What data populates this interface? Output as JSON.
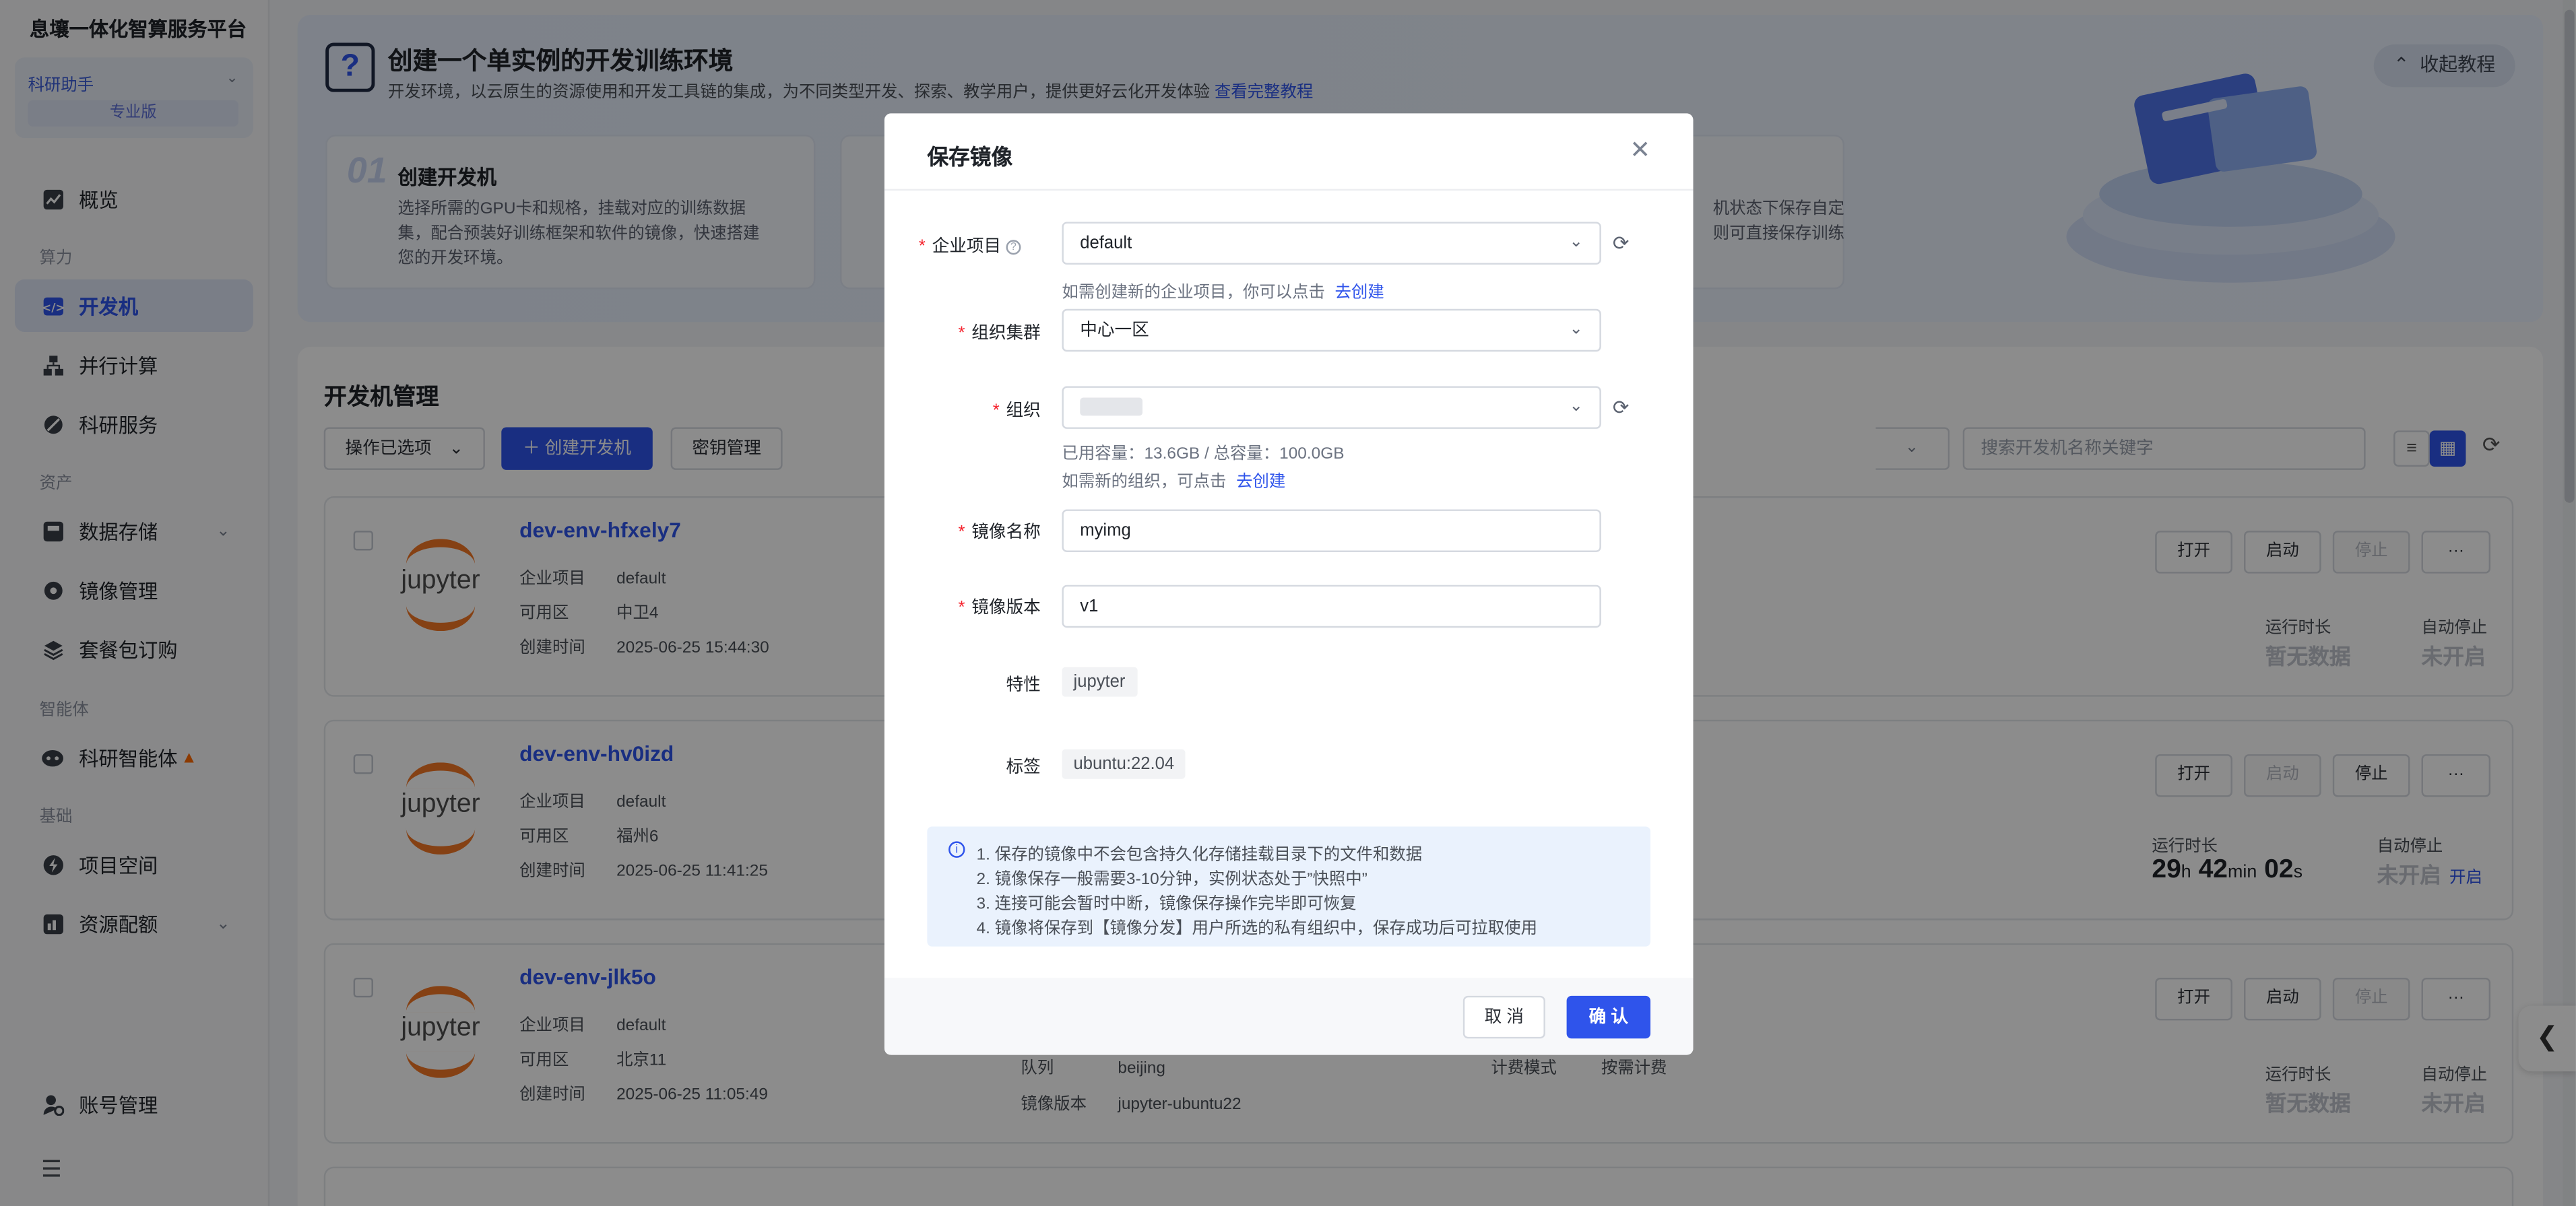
{
  "sidebar": {
    "brand": "息壤一体化智算服务平台",
    "project": {
      "name": "科研助手",
      "edition": "专业版"
    },
    "items": [
      {
        "label": "概览"
      },
      {
        "section": "算力"
      },
      {
        "label": "开发机"
      },
      {
        "label": "并行计算"
      },
      {
        "label": "科研服务"
      },
      {
        "section": "资产"
      },
      {
        "label": "数据存储"
      },
      {
        "label": "镜像管理"
      },
      {
        "label": "套餐包订购"
      },
      {
        "section": "智能体"
      },
      {
        "label": "科研智能体"
      },
      {
        "section": "基础"
      },
      {
        "label": "项目空间"
      },
      {
        "label": "资源配额"
      },
      {
        "label": "账号管理"
      }
    ]
  },
  "hero": {
    "title": "创建一个单实例的开发训练环境",
    "subtitle": "开发环境，以云原生的资源使用和开发工具链的集成，为不同类型开发、探索、教学用户，提供更好云化开发体验",
    "link": "查看完整教程",
    "collapse": "收起教程",
    "step1": {
      "num": "01",
      "title": "创建开发机",
      "desc": "选择所需的GPU卡和规格，挂载对应的训练数据集，配合预装好训练框架和软件的镜像，快速搭建您的开发环境。"
    },
    "step3": {
      "desc1": "机状态下保存自定",
      "desc2": "则可直接保存训练"
    }
  },
  "panel": {
    "title": "开发机管理",
    "ops": "操作已选项",
    "create": "创建开发机",
    "keys": "密钥管理",
    "search_placeholder": "搜索开发机名称关键字"
  },
  "instances": [
    {
      "name": "dev-env-hfxely7",
      "project_k": "企业项目",
      "project_v": "default",
      "zone_k": "可用区",
      "zone_v": "中卫4",
      "time_k": "创建时间",
      "time_v": "2025-06-25 15:44:30",
      "runtime": "暂无数据",
      "autostop": "未开启"
    },
    {
      "name": "dev-env-hv0izd",
      "project_k": "企业项目",
      "project_v": "default",
      "zone_k": "可用区",
      "zone_v": "福州6",
      "time_k": "创建时间",
      "time_v": "2025-06-25 11:41:25",
      "runtime": {
        "h": "29",
        "m": "42",
        "s": "02"
      },
      "autostop": "未开启",
      "open": "开启"
    },
    {
      "name": "dev-env-jlk5o",
      "project_k": "企业项目",
      "project_v": "default",
      "zone_k": "可用区",
      "zone_v": "北京11",
      "time_k": "创建时间",
      "time_v": "2025-06-25 11:05:49",
      "queue_k": "队列",
      "queue_v": "beijing",
      "ver_k": "镜像版本",
      "ver_v": "jupyter-ubuntu22",
      "bill_k": "计费模式",
      "bill_v": "按需计费",
      "runtime": "暂无数据",
      "autostop": "未开启"
    }
  ],
  "actions": {
    "open": "打开",
    "start": "启动",
    "stop": "停止",
    "more": "···"
  },
  "labels": {
    "runtime": "运行时长",
    "autostop": "自动停止",
    "h": "h",
    "min": "min",
    "s": "s"
  },
  "jupyter": "jupyter",
  "modal": {
    "title": "保存镜像",
    "project_label": "企业项目",
    "project_value": "default",
    "project_hint": "如需创建新的企业项目，你可以点击",
    "project_link": "去创建",
    "cluster_label": "组织集群",
    "cluster_value": "中心一区",
    "org_label": "组织",
    "org_usage": "已用容量：13.6GB / 总容量：100.0GB",
    "org_hint": "如需新的组织，可点击",
    "org_link": "去创建",
    "name_label": "镜像名称",
    "name_value": "myimg",
    "version_label": "镜像版本",
    "version_value": "v1",
    "feature_label": "特性",
    "feature_value": "jupyter",
    "tag_label": "标签",
    "tag_value": "ubuntu:22.04",
    "notice": [
      "1. 保存的镜像中不会包含持久化存储挂载目录下的文件和数据",
      "2. 镜像保存一般需要3-10分钟，实例状态处于”快照中”",
      "3. 连接可能会暂时中断，镜像保存操作完毕即可恢复",
      "4. 镜像将保存到【镜像分发】用户所选的私有组织中，保存成功后可拉取使用"
    ],
    "cancel": "取 消",
    "ok": "确 认"
  }
}
